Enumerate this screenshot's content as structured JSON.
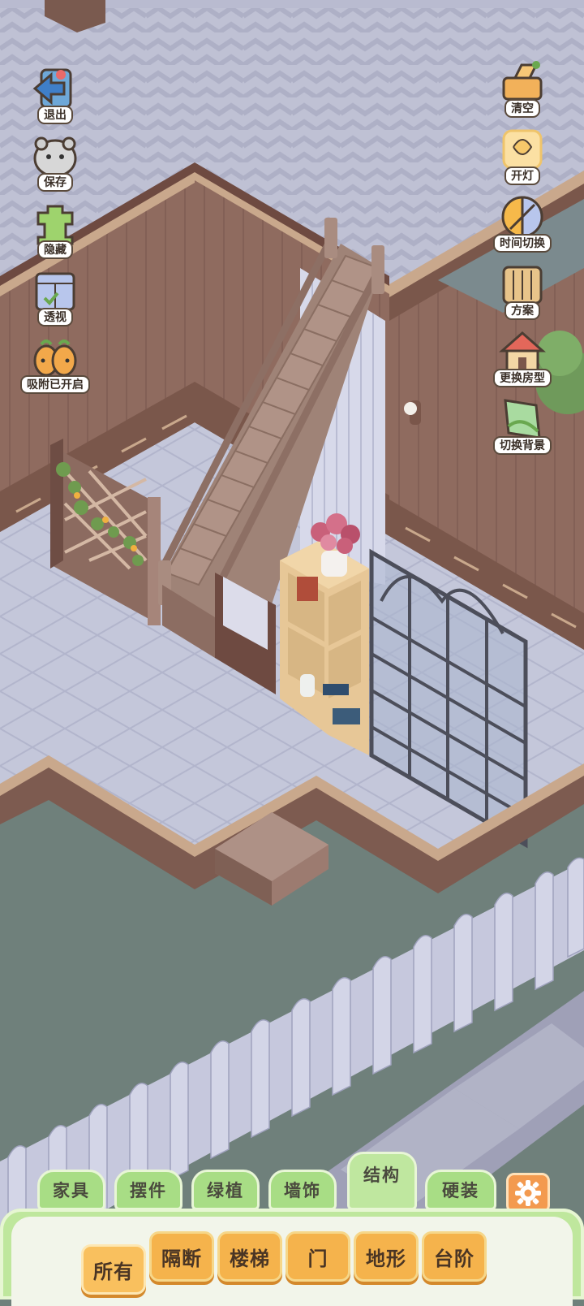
{
  "left_buttons": [
    {
      "label": "退出",
      "icon": "exit-arrow-icon"
    },
    {
      "label": "保存",
      "icon": "hamster-save-icon"
    },
    {
      "label": "隐藏",
      "icon": "hide-frame-icon"
    },
    {
      "label": "透视",
      "icon": "perspective-box-icon"
    },
    {
      "label": "吸附已开启",
      "icon": "magnet-snap-icon"
    }
  ],
  "right_buttons": [
    {
      "label": "清空",
      "icon": "clear-broom-icon"
    },
    {
      "label": "开灯",
      "icon": "lamp-icon"
    },
    {
      "label": "时间切换",
      "icon": "sun-moon-icon"
    },
    {
      "label": "方案",
      "icon": "scheme-cards-icon"
    },
    {
      "label": "更换房型",
      "icon": "house-layout-icon"
    },
    {
      "label": "切换背景",
      "icon": "background-swap-icon"
    }
  ],
  "category_tabs": [
    {
      "label": "家具",
      "active": false
    },
    {
      "label": "摆件",
      "active": false
    },
    {
      "label": "绿植",
      "active": false
    },
    {
      "label": "墙饰",
      "active": false
    },
    {
      "label": "结构",
      "active": true
    },
    {
      "label": "硬装",
      "active": false
    }
  ],
  "sub_tabs": [
    {
      "label": "所有",
      "active": true
    },
    {
      "label": "隔断",
      "active": false
    },
    {
      "label": "楼梯",
      "active": false
    },
    {
      "label": "门",
      "active": false
    },
    {
      "label": "地形",
      "active": false
    },
    {
      "label": "台阶",
      "active": false
    }
  ],
  "settings_icon": "gear-icon",
  "colors": {
    "wall": "#8e6a5e",
    "floor": "#c9cbdc",
    "tab_green": "#a8dd85",
    "sub_orange": "#f5b34c",
    "settings_orange": "#f39a4f"
  }
}
